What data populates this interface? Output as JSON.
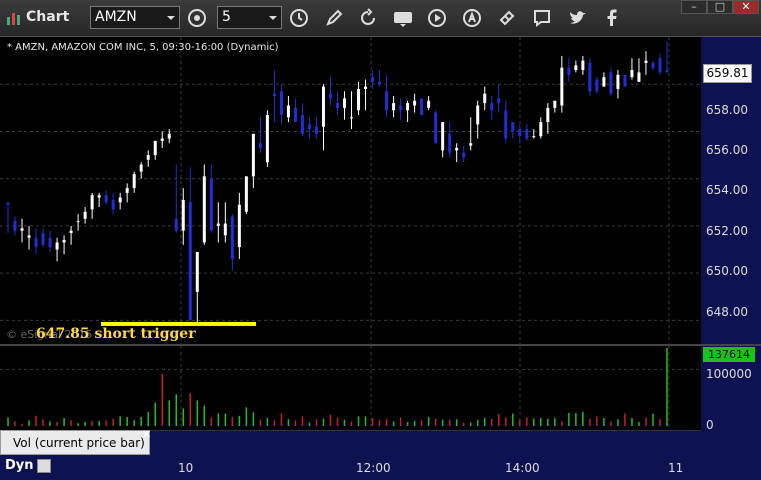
{
  "window": {
    "title": "Chart"
  },
  "toolbar": {
    "symbol": "AMZN",
    "interval": "5"
  },
  "chart": {
    "symbol_line": "* AMZN, AMAZON COM INC, 5, 09:30-16:00 (Dynamic)",
    "annotation": "647.85 short trigger",
    "watermark": "© eSignal 2015",
    "last_price": "659.81",
    "y_ticks": [
      "658.00",
      "656.00",
      "654.00",
      "652.00",
      "650.00",
      "648.00"
    ],
    "volume_ticks": [
      "100000",
      "0"
    ],
    "last_volume": "137614",
    "x_ticks": [
      "10",
      "12:00",
      "14:00",
      "11"
    ],
    "volume_label": "Vol (current price bar)",
    "mode_label": "Dyn"
  },
  "colors": {
    "up": "#ffffff",
    "down": "#1f2fd8",
    "vol_up": "#1fbf1f",
    "vol_down": "#c81f1f",
    "trigger": "#ffff00",
    "axis_bg": "#0d1250"
  },
  "chart_data": {
    "type": "candlestick",
    "candles": [
      [
        653.0,
        652.9,
        651.7,
        652.9
      ],
      [
        652.2,
        652.4,
        651.6,
        651.8
      ],
      [
        651.8,
        652.3,
        651.3,
        651.9
      ],
      [
        651.5,
        652.0,
        651.0,
        651.6
      ],
      [
        651.5,
        651.9,
        650.8,
        651.1
      ],
      [
        651.7,
        651.9,
        651.1,
        651.2
      ],
      [
        651.5,
        651.8,
        650.9,
        651.1
      ],
      [
        651.0,
        651.5,
        650.5,
        651.3
      ],
      [
        651.3,
        651.6,
        650.8,
        651.4
      ],
      [
        651.7,
        652.0,
        651.2,
        651.8
      ],
      [
        652.2,
        652.5,
        651.8,
        652.2
      ],
      [
        652.3,
        652.8,
        652.1,
        652.6
      ],
      [
        652.7,
        653.4,
        652.3,
        653.3
      ],
      [
        653.2,
        653.4,
        652.8,
        653.3
      ],
      [
        653.3,
        653.5,
        652.9,
        653.0
      ],
      [
        653.1,
        653.4,
        652.5,
        652.7
      ],
      [
        653.0,
        653.4,
        652.7,
        653.2
      ],
      [
        653.4,
        653.8,
        653.0,
        653.6
      ],
      [
        653.6,
        654.3,
        653.4,
        654.2
      ],
      [
        654.3,
        654.7,
        654.0,
        654.6
      ],
      [
        654.8,
        655.2,
        654.5,
        655.0
      ],
      [
        655.0,
        655.6,
        654.8,
        655.6
      ],
      [
        655.6,
        656.0,
        655.3,
        655.7
      ],
      [
        655.7,
        656.1,
        655.5,
        655.9
      ],
      [
        652.3,
        654.6,
        651.7,
        651.8
      ],
      [
        651.8,
        653.6,
        651.2,
        653.1
      ],
      [
        653.0,
        654.5,
        648.8,
        648.0
      ],
      [
        649.2,
        650.9,
        647.8,
        650.9
      ],
      [
        651.3,
        654.6,
        651.2,
        654.1
      ],
      [
        654.0,
        654.6,
        651.7,
        651.8
      ],
      [
        652.0,
        653.0,
        651.3,
        652.1
      ],
      [
        651.6,
        653.0,
        651.3,
        652.1
      ],
      [
        652.4,
        652.5,
        650.1,
        650.6
      ],
      [
        651.1,
        653.4,
        650.6,
        652.9
      ],
      [
        652.6,
        654.1,
        652.5,
        654.1
      ],
      [
        654.1,
        655.9,
        653.6,
        655.9
      ],
      [
        655.5,
        656.6,
        655.1,
        655.3
      ],
      [
        654.7,
        656.9,
        654.5,
        656.7
      ],
      [
        657.6,
        658.6,
        656.4,
        657.5
      ],
      [
        657.7,
        658.0,
        656.3,
        656.7
      ],
      [
        656.6,
        657.5,
        656.4,
        657.1
      ],
      [
        657.0,
        657.4,
        656.4,
        656.4
      ],
      [
        656.7,
        657.2,
        655.8,
        655.9
      ],
      [
        656.3,
        656.6,
        655.7,
        656.1
      ],
      [
        656.2,
        656.6,
        655.7,
        655.9
      ],
      [
        656.2,
        658.0,
        655.2,
        657.9
      ],
      [
        657.6,
        658.3,
        657.1,
        657.4
      ],
      [
        657.2,
        657.7,
        656.7,
        657.0
      ],
      [
        657.0,
        657.7,
        656.5,
        657.4
      ],
      [
        656.6,
        657.7,
        656.1,
        656.6
      ],
      [
        656.9,
        658.1,
        656.7,
        657.8
      ],
      [
        657.8,
        658.2,
        656.9,
        657.9
      ],
      [
        658.3,
        658.6,
        657.8,
        658.1
      ],
      [
        658.1,
        658.6,
        657.9,
        658.0
      ],
      [
        657.7,
        658.4,
        656.6,
        656.9
      ],
      [
        656.9,
        657.5,
        656.6,
        657.2
      ],
      [
        657.1,
        657.4,
        656.5,
        656.9
      ],
      [
        656.9,
        657.3,
        656.4,
        657.2
      ],
      [
        657.1,
        657.6,
        656.8,
        657.3
      ],
      [
        657.4,
        657.3,
        656.7,
        656.7
      ],
      [
        657.0,
        657.5,
        656.9,
        657.3
      ],
      [
        656.8,
        656.9,
        655.5,
        655.5
      ],
      [
        655.2,
        656.4,
        654.9,
        656.4
      ],
      [
        655.9,
        656.4,
        654.9,
        655.1
      ],
      [
        655.2,
        655.5,
        654.7,
        655.3
      ],
      [
        655.1,
        655.4,
        654.7,
        654.9
      ],
      [
        655.4,
        656.6,
        655.2,
        655.5
      ],
      [
        656.3,
        657.3,
        655.7,
        657.1
      ],
      [
        657.2,
        657.9,
        656.9,
        657.6
      ],
      [
        657.2,
        657.5,
        656.5,
        656.9
      ],
      [
        657.4,
        658.0,
        656.8,
        657.2
      ],
      [
        656.9,
        657.3,
        655.5,
        655.7
      ],
      [
        656.4,
        656.4,
        655.7,
        656.0
      ],
      [
        656.1,
        656.3,
        655.5,
        655.8
      ],
      [
        656.1,
        656.3,
        655.6,
        655.7
      ],
      [
        655.8,
        656.1,
        655.7,
        655.8
      ],
      [
        655.8,
        656.6,
        655.7,
        656.4
      ],
      [
        656.4,
        657.2,
        655.9,
        657.0
      ],
      [
        657.0,
        657.3,
        656.8,
        657.3
      ],
      [
        657.1,
        659.2,
        656.8,
        658.7
      ],
      [
        658.7,
        659.1,
        658.1,
        658.4
      ],
      [
        658.6,
        659.0,
        658.5,
        658.8
      ],
      [
        658.6,
        659.2,
        658.4,
        659.0
      ],
      [
        658.9,
        659.1,
        657.5,
        657.7
      ],
      [
        658.2,
        658.3,
        657.6,
        657.7
      ],
      [
        657.9,
        658.5,
        657.9,
        658.3
      ],
      [
        658.5,
        658.7,
        657.5,
        657.6
      ],
      [
        657.8,
        658.6,
        657.4,
        658.4
      ],
      [
        658.4,
        658.4,
        657.9,
        657.9
      ],
      [
        658.3,
        659.1,
        658.2,
        658.6
      ],
      [
        658.1,
        659.1,
        658.2,
        658.5
      ],
      [
        658.9,
        659.4,
        658.4,
        659.0
      ],
      [
        658.9,
        659.0,
        658.6,
        658.7
      ],
      [
        659.1,
        659.3,
        658.4,
        658.5
      ],
      [
        658.6,
        659.8,
        658.5,
        658.5
      ]
    ],
    "volumes": [
      15000,
      8000,
      4000,
      10000,
      18000,
      12000,
      8000,
      7000,
      14000,
      10000,
      5000,
      7000,
      9000,
      9000,
      10000,
      13000,
      17000,
      16000,
      10000,
      16000,
      25000,
      41000,
      92000,
      45000,
      56000,
      31000,
      58000,
      45000,
      36000,
      15000,
      22000,
      22000,
      16000,
      18000,
      33000,
      24000,
      11000,
      14000,
      10000,
      22000,
      12000,
      10000,
      17000,
      6000,
      12000,
      13000,
      20000,
      15000,
      11000,
      8000,
      17000,
      17000,
      14000,
      11000,
      12000,
      8000,
      15000,
      7000,
      9000,
      10000,
      16000,
      13000,
      11000,
      11000,
      12000,
      6000,
      6000,
      11000,
      14000,
      13000,
      21000,
      15000,
      22000,
      11000,
      15000,
      13000,
      14000,
      13000,
      14000,
      8000,
      23000,
      23000,
      25000,
      13000,
      17000,
      14000,
      8000,
      12000,
      22000,
      14000,
      7000,
      15000,
      22000,
      12000,
      137614
    ],
    "volume_up": [
      true,
      false,
      false,
      true,
      false,
      false,
      true,
      false,
      true,
      false,
      true,
      true,
      false,
      true,
      false,
      false,
      true,
      true,
      true,
      true,
      true,
      true,
      false,
      true,
      true,
      true,
      false,
      true,
      true,
      false,
      true,
      true,
      false,
      true,
      true,
      true,
      false,
      true,
      false,
      false,
      true,
      false,
      false,
      true,
      false,
      true,
      false,
      false,
      true,
      false,
      true,
      true,
      false,
      false,
      false,
      true,
      false,
      true,
      true,
      false,
      true,
      false,
      true,
      false,
      true,
      false,
      true,
      true,
      true,
      false,
      false,
      false,
      true,
      false,
      false,
      true,
      true,
      true,
      true,
      false,
      true,
      true,
      true,
      false,
      false,
      true,
      false,
      true,
      false,
      true,
      true,
      false,
      true,
      false,
      true
    ],
    "ylim": [
      647.0,
      660.0
    ],
    "volume_max": 137614,
    "x_ticks": [
      "10",
      "12:00",
      "14:00",
      "11"
    ],
    "trigger_level": 647.85,
    "grid": true
  }
}
